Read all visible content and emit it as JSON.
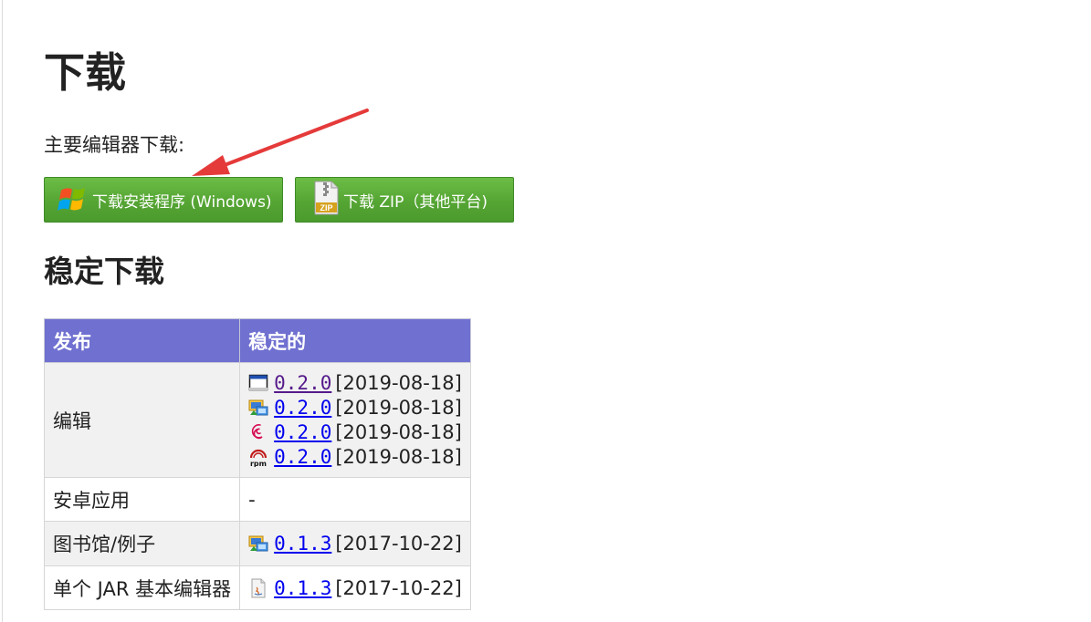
{
  "page": {
    "title": "下载",
    "subtitle": "主要编辑器下载:",
    "stable_heading": "稳定下载"
  },
  "buttons": {
    "windows_label": "下载安装程序 (Windows)",
    "zip_label": "下载 ZIP（其他平台)",
    "zip_icon_text": "ZIP"
  },
  "table": {
    "headers": [
      "发布",
      "稳定的"
    ],
    "rows": [
      {
        "label": "编辑",
        "versions": [
          {
            "icon": "window-icon",
            "version": "0.2.0",
            "date": "[2019-08-18]"
          },
          {
            "icon": "installer-icon",
            "version": "0.2.0",
            "date": "[2019-08-18]"
          },
          {
            "icon": "debian-icon",
            "version": "0.2.0",
            "date": "[2019-08-18]"
          },
          {
            "icon": "rpm-icon",
            "version": "0.2.0",
            "date": "[2019-08-18]"
          }
        ]
      },
      {
        "label": "安卓应用",
        "value": "-"
      },
      {
        "label": "图书馆/例子",
        "versions": [
          {
            "icon": "installer-icon",
            "version": "0.1.3",
            "date": "[2017-10-22]"
          }
        ]
      },
      {
        "label": "单个 JAR 基本编辑器",
        "versions": [
          {
            "icon": "jar-icon",
            "version": "0.1.3",
            "date": "[2017-10-22]"
          }
        ]
      }
    ],
    "rpm_icon_text": "rpm"
  },
  "colors": {
    "header_bg": "#6f70d0",
    "button_green": "#55a534",
    "link": "#0000ee",
    "visited_link": "#551a8b",
    "arrow": "#e53a3a"
  }
}
